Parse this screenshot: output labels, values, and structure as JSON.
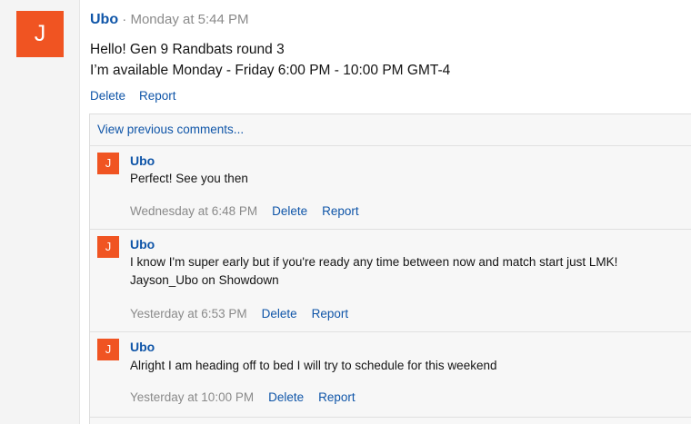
{
  "post": {
    "avatar_initial": "J",
    "author": "Ubo",
    "separator": "·",
    "time": "Monday at 5:44 PM",
    "body_lines": [
      "Hello! Gen 9 Randbats round 3",
      "I’m available Monday - Friday 6:00 PM - 10:00 PM GMT-4"
    ],
    "actions": {
      "delete": "Delete",
      "report": "Report"
    }
  },
  "comments_section": {
    "view_previous": "View previous comments...",
    "comments": [
      {
        "avatar_initial": "J",
        "author": "Ubo",
        "lines": [
          "Perfect! See you then"
        ],
        "time": "Wednesday at 6:48 PM",
        "delete": "Delete",
        "report": "Report"
      },
      {
        "avatar_initial": "J",
        "author": "Ubo",
        "lines": [
          "I know I'm super early but if you're ready any time between now and match start just LMK!",
          "Jayson_Ubo on Showdown"
        ],
        "time": "Yesterday at 6:53 PM",
        "delete": "Delete",
        "report": "Report"
      },
      {
        "avatar_initial": "J",
        "author": "Ubo",
        "lines": [
          "Alright I am heading off to bed I will try to schedule for this weekend"
        ],
        "time": "Yesterday at 10:00 PM",
        "delete": "Delete",
        "report": "Report"
      }
    ]
  },
  "colors": {
    "avatar": "#f05422",
    "link": "#0f55a8",
    "meta": "#8a8a8a"
  }
}
